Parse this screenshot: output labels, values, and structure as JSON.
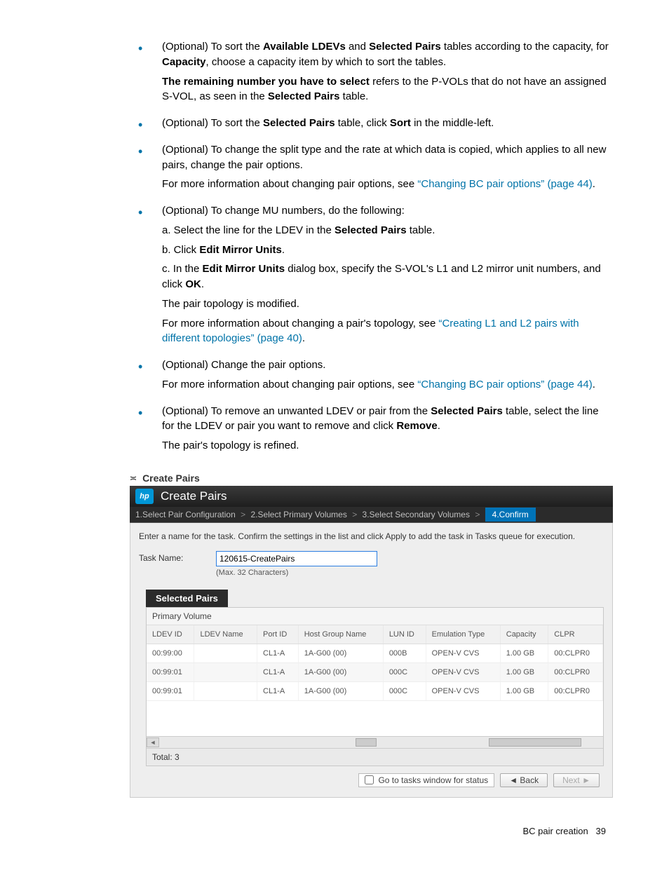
{
  "bullets": {
    "b1_p1a": "(Optional) To sort the ",
    "b1_p1b": "Available LDEVs",
    "b1_p1c": " and ",
    "b1_p1d": "Selected Pairs",
    "b1_p1e": " tables according to the capacity, for ",
    "b1_p1f": "Capacity",
    "b1_p1g": ", choose a capacity item by which to sort the tables.",
    "b1_p2a": "The remaining number you have to select",
    "b1_p2b": " refers to the P-VOLs that do not have an assigned S-VOL, as seen in the ",
    "b1_p2c": "Selected Pairs",
    "b1_p2d": " table.",
    "b2a": "(Optional) To sort the ",
    "b2b": "Selected Pairs",
    "b2c": " table, click ",
    "b2d": "Sort",
    "b2e": " in the middle-left.",
    "b3_p1": "(Optional) To change the split type and the rate at which data is copied, which applies to all new pairs, change the pair options.",
    "b3_p2": "For more information about changing pair options, see ",
    "b3_link": "“Changing BC pair options” (page 44)",
    "b3_dot": ".",
    "b4_intro": "(Optional) To change MU numbers, do the following:",
    "b4_a1": "a. Select the line for the LDEV in the ",
    "b4_a1b": "Selected Pairs",
    "b4_a1c": " table.",
    "b4_b1": "b. Click ",
    "b4_b1b": "Edit Mirror Units",
    "b4_b1c": ".",
    "b4_c1": "c. In the ",
    "b4_c1b": "Edit Mirror Units",
    "b4_c1c": " dialog box, specify the S-VOL's L1 and L2 mirror unit numbers, and click ",
    "b4_c1d": "OK",
    "b4_c1e": ".",
    "b4_p2": "The pair topology is modified.",
    "b4_p3": "For more information about changing a pair's topology, see ",
    "b4_link": "“Creating L1 and L2 pairs with different topologies” (page 40)",
    "b4_dot": ".",
    "b5_p1": "(Optional) Change the pair options.",
    "b5_p2": "For more information about changing pair options, see ",
    "b5_link": "“Changing BC pair options” (page 44)",
    "b5_dot": ".",
    "b6_p1a": "(Optional) To remove an unwanted LDEV or pair from the ",
    "b6_p1b": "Selected Pairs",
    "b6_p1c": " table, select the line for the LDEV or pair you want to remove and click ",
    "b6_p1d": "Remove",
    "b6_p1e": ".",
    "b6_p2": "The pair's topology is refined."
  },
  "dialog": {
    "collapse_label": "Create Pairs",
    "hp": "hp",
    "title": "Create Pairs",
    "steps": {
      "s1": "1.Select Pair Configuration",
      "s2": "2.Select Primary Volumes",
      "s3": "3.Select Secondary Volumes",
      "s4": "4.Confirm",
      "sep": ">"
    },
    "instruction": "Enter a name for the task. Confirm the settings in the list and click Apply to add the task in Tasks queue for execution.",
    "task_label": "Task Name:",
    "task_value": "120615-CreatePairs",
    "task_hint": "(Max. 32 Characters)",
    "tab": "Selected Pairs",
    "sub_header": "Primary Volume",
    "columns": [
      "LDEV ID",
      "LDEV Name",
      "Port ID",
      "Host Group Name",
      "LUN ID",
      "Emulation Type",
      "Capacity",
      "CLPR"
    ],
    "rows": [
      {
        "ldev_id": "00:99:00",
        "ldev_name": "",
        "port_id": "CL1-A",
        "hg": "1A-G00 (00)",
        "lun": "000B",
        "emu": "OPEN-V CVS",
        "cap": "1.00 GB",
        "clpr": "00:CLPR0"
      },
      {
        "ldev_id": "00:99:01",
        "ldev_name": "",
        "port_id": "CL1-A",
        "hg": "1A-G00 (00)",
        "lun": "000C",
        "emu": "OPEN-V CVS",
        "cap": "1.00 GB",
        "clpr": "00:CLPR0"
      },
      {
        "ldev_id": "00:99:01",
        "ldev_name": "",
        "port_id": "CL1-A",
        "hg": "1A-G00 (00)",
        "lun": "000C",
        "emu": "OPEN-V CVS",
        "cap": "1.00 GB",
        "clpr": "00:CLPR0"
      }
    ],
    "total_label": "Total:  3",
    "footer": {
      "checkbox": "Go to tasks window for status",
      "back": "Back",
      "next": "Next"
    }
  },
  "page_footer": {
    "section": "BC pair creation",
    "page": "39"
  }
}
